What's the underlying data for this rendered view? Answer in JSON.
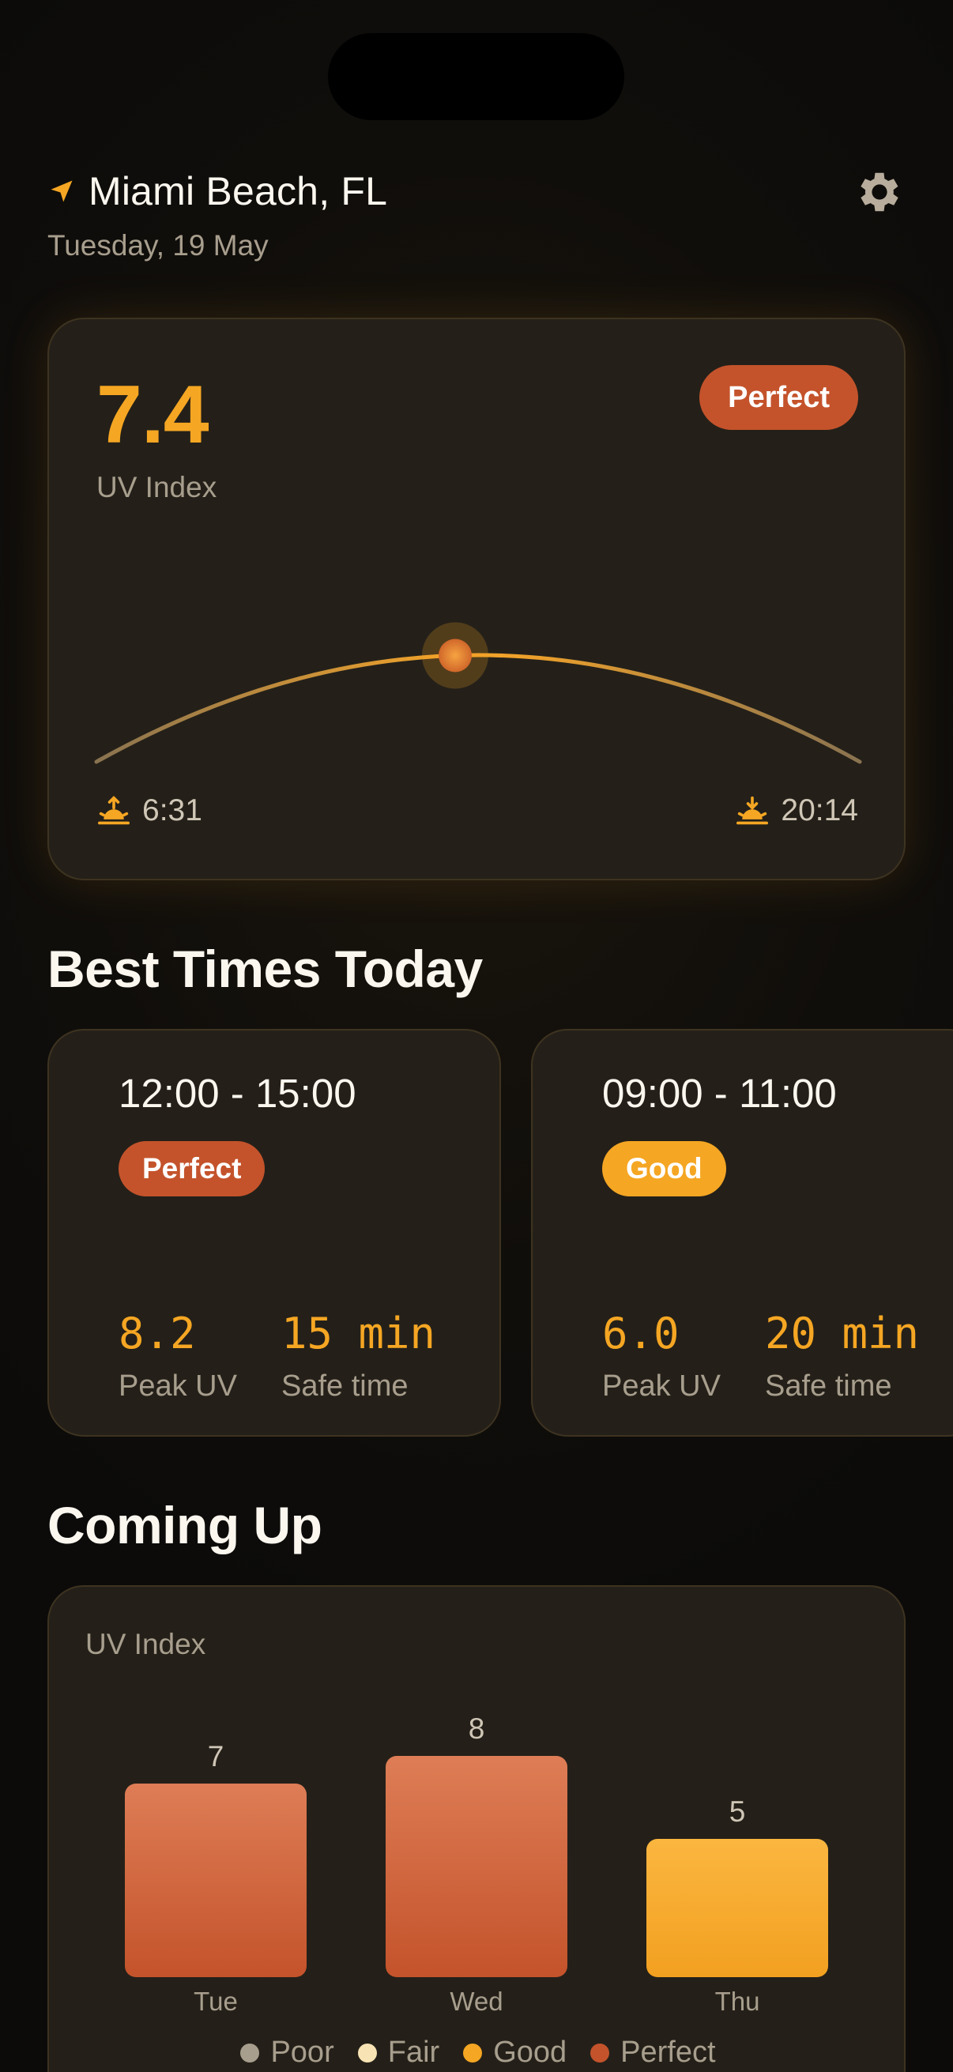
{
  "header": {
    "location": "Miami Beach, FL",
    "date": "Tuesday, 19 May"
  },
  "uv_card": {
    "value": "7.4",
    "label": "UV Index",
    "badge": "Perfect",
    "sunrise": "6:31",
    "sunset": "20:14",
    "sun_progress": 0.47
  },
  "sections": {
    "best_times": "Best Times Today",
    "coming_up": "Coming Up"
  },
  "best_times": [
    {
      "range": "12:00 - 15:00",
      "rating": "Perfect",
      "peak_uv": "8.2",
      "peak_label": "Peak UV",
      "safe_time": "15 min",
      "safe_label": "Safe time"
    },
    {
      "range": "09:00 - 11:00",
      "rating": "Good",
      "peak_uv": "6.0",
      "peak_label": "Peak UV",
      "safe_time": "20 min",
      "safe_label": "Safe time"
    }
  ],
  "forecast": {
    "label": "UV Index",
    "legend": [
      "Poor",
      "Fair",
      "Good",
      "Perfect"
    ]
  },
  "colors": {
    "accent": "#f5a623",
    "perfect": "#c4532b",
    "poor": "#a89e8d",
    "fair": "#f8e3b4",
    "good": "#f5a623"
  },
  "chart_data": {
    "type": "bar",
    "categories": [
      "Tue",
      "Wed",
      "Thu"
    ],
    "values": [
      7,
      8,
      5
    ],
    "ratings": [
      "Perfect",
      "Perfect",
      "Good"
    ],
    "ylabel": "UV Index",
    "ylim": [
      0,
      12
    ]
  }
}
